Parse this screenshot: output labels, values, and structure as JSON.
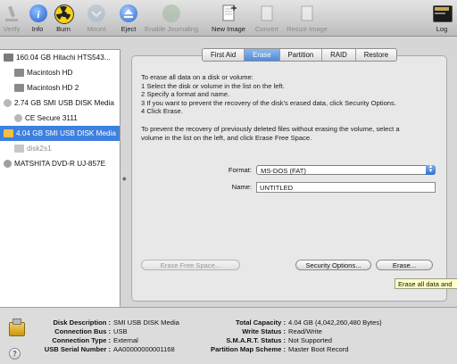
{
  "toolbar": {
    "verify": "Verify",
    "info": "Info",
    "burn": "Burn",
    "mount": "Mount",
    "eject": "Eject",
    "enable_journaling": "Enable Journaling",
    "new_image": "New Image",
    "convert": "Convert",
    "resize_image": "Resize Image",
    "log": "Log",
    "log_badge": "WARN\n7:36"
  },
  "sidebar": {
    "items": [
      {
        "label": "160.04 GB Hitachi HTS543..."
      },
      {
        "label": "Macintosh HD"
      },
      {
        "label": "Macintosh HD 2"
      },
      {
        "label": "2.74 GB SMI USB DISK Media"
      },
      {
        "label": "CE Secure 3111"
      },
      {
        "label": "4.04 GB SMI USB DISK Media"
      },
      {
        "label": "disk2s1"
      },
      {
        "label": "MATSHITA DVD-R UJ-857E"
      }
    ]
  },
  "tabs": [
    "First Aid",
    "Erase",
    "Partition",
    "RAID",
    "Restore"
  ],
  "erase": {
    "instructions": [
      "To erase all data on a disk or volume:",
      "1 Select the disk or volume in the list on the left.",
      "2 Specify a format and name.",
      "3 If you want to prevent the recovery of the disk's erased data, click Security Options.",
      "4 Click Erase."
    ],
    "free_space_note_1": "To prevent the recovery of previously deleted files without erasing the volume, select a",
    "free_space_note_2": "volume in the list on the left, and click Erase Free Space.",
    "format_label": "Format:",
    "format_value": "MS-DOS (FAT)",
    "name_label": "Name:",
    "name_value": "UNTITLED",
    "erase_free_space_button": "Erase Free Space...",
    "security_options_button": "Security Options...",
    "erase_button": "Erase...",
    "tooltip": "Erase all data and"
  },
  "info": {
    "left": [
      {
        "k": "Disk Description :",
        "v": "SMI USB DISK Media"
      },
      {
        "k": "Connection Bus :",
        "v": "USB"
      },
      {
        "k": "Connection Type :",
        "v": "External"
      },
      {
        "k": "USB Serial Number :",
        "v": "AA00000000001168"
      }
    ],
    "right": [
      {
        "k": "Total Capacity :",
        "v": "4.04 GB (4,042,260,480 Bytes)"
      },
      {
        "k": "Write Status :",
        "v": "Read/Write"
      },
      {
        "k": "S.M.A.R.T. Status :",
        "v": "Not Supported"
      },
      {
        "k": "Partition Map Scheme :",
        "v": "Master Boot Record"
      }
    ],
    "help": "?"
  },
  "colors": {
    "selection": "#3d80df",
    "accent": "#4f8ad8"
  }
}
